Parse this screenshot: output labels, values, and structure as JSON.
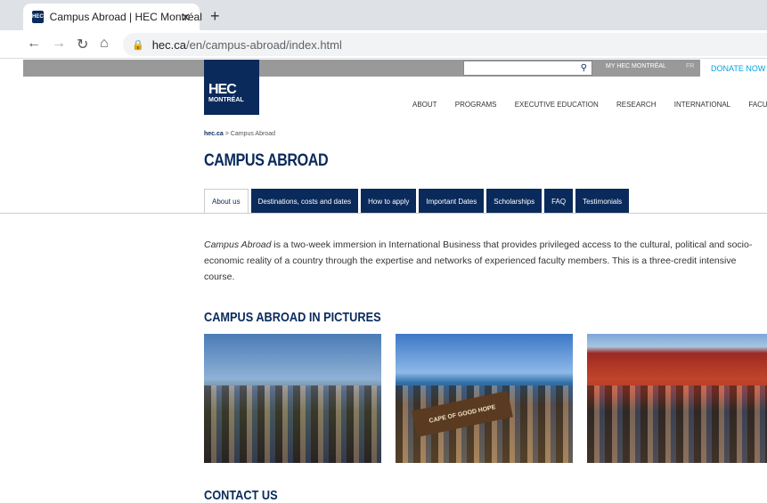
{
  "browser": {
    "tab_title": "Campus Abroad | HEC Montréal",
    "favicon_text": "HEC",
    "close": "✕",
    "new_tab": "+",
    "url_host": "hec.ca",
    "url_path": "/en/campus-abroad/index.html"
  },
  "topbar": {
    "search_icon": "⚲",
    "my_hec": "MY HEC MONTRÉAL",
    "lang": "FR",
    "donate": "DONATE NOW"
  },
  "logo": {
    "line1": "HEC",
    "line2": "MONTRÉAL"
  },
  "nav": [
    "ABOUT",
    "PROGRAMS",
    "EXECUTIVE EDUCATION",
    "RESEARCH",
    "INTERNATIONAL",
    "FACULTY"
  ],
  "breadcrumb": {
    "home": "hec.ca",
    "sep": " > ",
    "current": "Campus Abroad"
  },
  "page_title": "CAMPUS ABROAD",
  "tabs": [
    "About us",
    "Destinations, costs and dates",
    "How to apply",
    "Important Dates",
    "Scholarships",
    "FAQ",
    "Testimonials"
  ],
  "intro": {
    "em": "Campus Abroad",
    "text": " is a two-week immersion in International Business that provides privileged access to the cultural, political and socio-economic reality of a country through the expertise and networks of experienced faculty members. This is a three-credit intensive course."
  },
  "pictures_heading": "CAMPUS ABROAD IN PICTURES",
  "sign_text": "CAPE OF GOOD HOPE",
  "contact_heading": "CONTACT US"
}
